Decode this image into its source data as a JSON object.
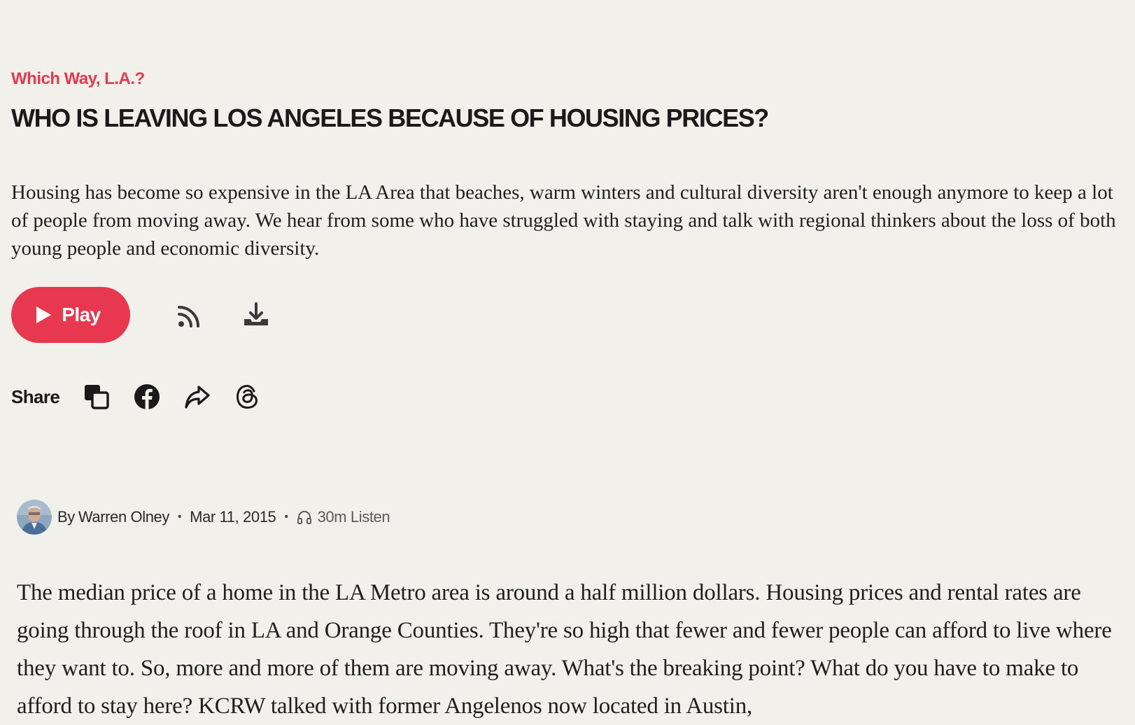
{
  "category": "Which Way, L.A.?",
  "title": "WHO IS LEAVING LOS ANGELES BECAUSE OF HOUSING PRICES?",
  "summary": "Housing has become so expensive in the LA Area that beaches, warm winters and cultural diversity aren't enough anymore to keep a lot of people from moving away. We hear from some who have struggled with staying and talk with regional thinkers about the loss of both young people and economic diversity.",
  "controls": {
    "play_label": "Play",
    "icons": [
      "play-icon",
      "rss-icon",
      "download-icon"
    ]
  },
  "share": {
    "label": "Share",
    "icons": [
      "copy-link-icon",
      "facebook-icon",
      "share-arrow-icon",
      "threads-icon"
    ]
  },
  "byline": {
    "by": "By",
    "author": "Warren Olney",
    "date": "Mar 11, 2015",
    "listen": "30m Listen"
  },
  "body": "The median price of a home in the LA Metro area is around a half million dollars. Housing prices and rental rates are going through the roof in LA and Orange Counties. They're so high that fewer and fewer people can afford to live where they want to. So, more and more of them are moving away. What's the breaking point? What do you have to make to afford to stay here? KCRW talked with former Angelenos now located in Austin,",
  "colors": {
    "accent": "#e8384f",
    "background": "#f1f0ea",
    "text": "#1c1c1c"
  }
}
